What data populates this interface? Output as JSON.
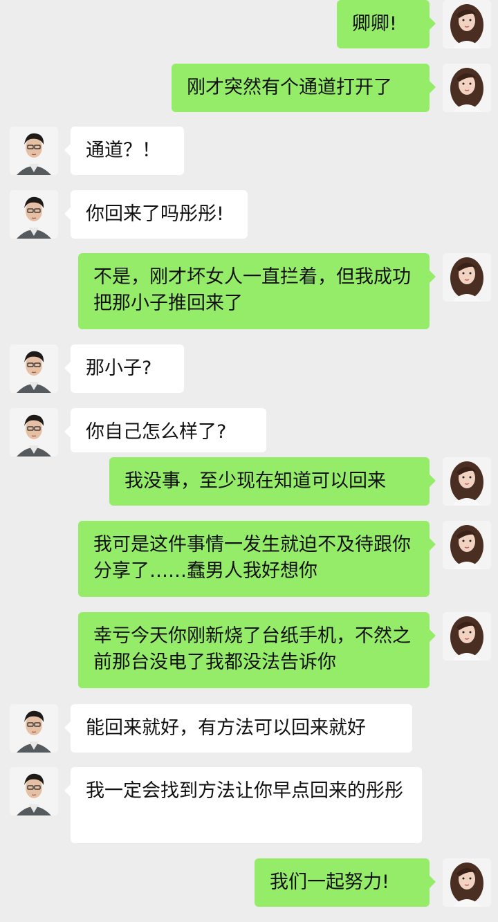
{
  "conversation": {
    "messages": [
      {
        "sender": "me",
        "text": "卿卿!"
      },
      {
        "sender": "me",
        "text": "刚才突然有个通道打开了"
      },
      {
        "sender": "them",
        "text": "通道？！"
      },
      {
        "sender": "them",
        "text": "你回来了吗彤彤!"
      },
      {
        "sender": "me",
        "text": "不是，刚才坏女人一直拦着，但我成功把那小子推回来了"
      },
      {
        "sender": "them",
        "text": "那小子?"
      },
      {
        "sender": "them",
        "text": "你自己怎么样了?"
      },
      {
        "sender": "me",
        "text": "我没事，至少现在知道可以回来"
      },
      {
        "sender": "me",
        "text": "我可是这件事情一发生就迫不及待跟你分享了……蠢男人我好想你"
      },
      {
        "sender": "me",
        "text": "幸亏今天你刚新烧了台纸手机，不然之前那台没电了我都没法告诉你"
      },
      {
        "sender": "them",
        "text": "能回来就好，有方法可以回来就好"
      },
      {
        "sender": "them",
        "text": "我一定会找到方法让你早点回来的彤彤"
      },
      {
        "sender": "me",
        "text": "我们一起努力!"
      }
    ]
  },
  "colors": {
    "background": "#ededed",
    "my_bubble": "#95ec69",
    "their_bubble": "#ffffff",
    "text": "#111111"
  },
  "icons": {
    "my_avatar": "girl-avatar-icon",
    "their_avatar": "boy-avatar-icon"
  }
}
